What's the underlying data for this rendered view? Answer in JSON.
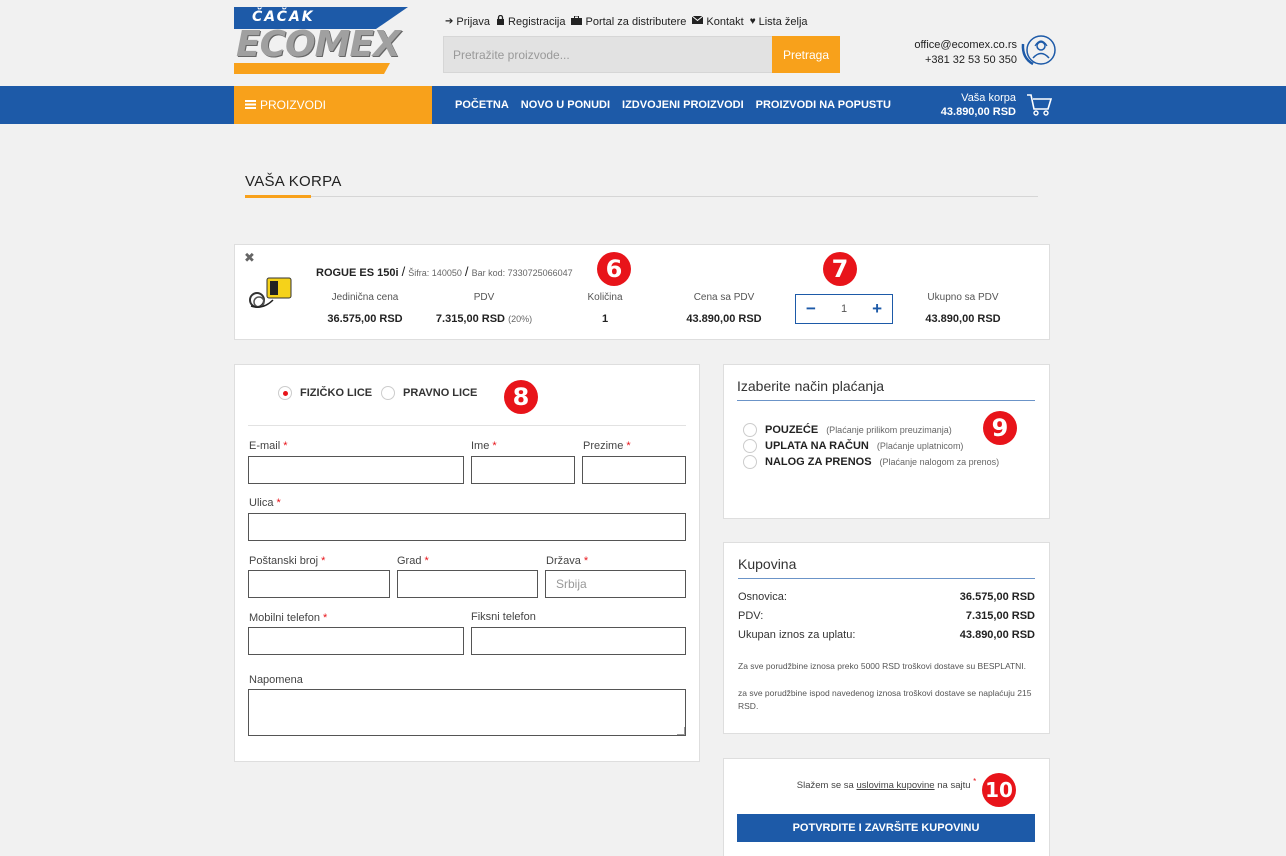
{
  "header": {
    "logo": {
      "top_text": "ČAČAK",
      "main_text": "ECOMEX"
    },
    "top_links": [
      {
        "icon": "sign-in-icon",
        "glyph": "➔",
        "label": "Prijava"
      },
      {
        "icon": "lock-icon",
        "glyph": "🔒",
        "label": "Registracija"
      },
      {
        "icon": "briefcase-icon",
        "glyph": "💼",
        "label": "Portal za distributere"
      },
      {
        "icon": "envelope-icon",
        "glyph": "✉",
        "label": "Kontakt"
      },
      {
        "icon": "heart-icon",
        "glyph": "♥",
        "label": "Lista želja"
      }
    ],
    "search": {
      "placeholder": "Pretražite proizvode...",
      "button": "Pretraga"
    },
    "contact": {
      "email": "office@ecomex.co.rs",
      "phone": "+381 32 53 50 350"
    }
  },
  "nav": {
    "products": "PROIZVODI",
    "links": [
      "POČETNA",
      "NOVO U PONUDI",
      "IZDVOJENI PROIZVODI",
      "PROIZVODI NA POPUSTU"
    ],
    "cart": {
      "label": "Vaša korpa",
      "amount": "43.890,00 RSD"
    }
  },
  "page": {
    "title": "VAŠA KORPA"
  },
  "cart_item": {
    "name": "ROGUE ES 150i",
    "sku": "Šifra: 140050",
    "barcode": "Bar kod: 7330725066047",
    "columns": {
      "unit_price": {
        "label": "Jedinična cena",
        "value": "36.575,00 RSD"
      },
      "vat": {
        "label": "PDV",
        "value": "7.315,00 RSD",
        "note": "(20%)"
      },
      "quantity": {
        "label": "Količina",
        "value": "1"
      },
      "price_with_vat": {
        "label": "Cena sa PDV",
        "value": "43.890,00 RSD"
      },
      "total_with_vat": {
        "label": "Ukupno sa PDV",
        "value": "43.890,00 RSD"
      }
    },
    "stepper": {
      "minus": "−",
      "value": "1",
      "plus": "+"
    }
  },
  "badges": {
    "b6": "6",
    "b7": "7",
    "b8": "8",
    "b9": "9",
    "b10": "10"
  },
  "customer_form": {
    "types": [
      {
        "label": "FIZIČKO LICE",
        "checked": true
      },
      {
        "label": "PRAVNO LICE",
        "checked": false
      }
    ],
    "fields": {
      "email": "E-mail",
      "first_name": "Ime",
      "last_name": "Prezime",
      "street": "Ulica",
      "postal": "Poštanski broj",
      "city": "Grad",
      "country": "Država",
      "country_placeholder": "Srbija",
      "mobile": "Mobilni telefon",
      "landline": "Fiksni telefon",
      "note": "Napomena"
    },
    "required_mark": "*"
  },
  "payment": {
    "title": "Izaberite način plaćanja",
    "options": [
      {
        "label": "POUZEĆE",
        "sub": "(Plaćanje prilikom preuzimanja)"
      },
      {
        "label": "UPLATA NA RAČUN",
        "sub": "(Plaćanje uplatnicom)"
      },
      {
        "label": "NALOG ZA PRENOS",
        "sub": "(Plaćanje nalogom za prenos)"
      }
    ]
  },
  "summary": {
    "title": "Kupovina",
    "rows": [
      {
        "label": "Osnovica:",
        "value": "36.575,00 RSD"
      },
      {
        "label": "PDV:",
        "value": "7.315,00 RSD"
      },
      {
        "label": "Ukupan iznos za uplatu:",
        "value": "43.890,00 RSD"
      }
    ],
    "note_1": "Za sve porudžbine iznosa preko 5000 RSD troškovi dostave su BESPLATNI.",
    "note_2": "za sve porudžbine ispod navedenog iznosa troškovi dostave se naplaćuju 215 RSD."
  },
  "terms": {
    "prefix": "Slažem se sa ",
    "link": "uslovima kupovine",
    "suffix": " na sajtu ",
    "required_mark": "*",
    "button": "POTVRDITE I ZAVRŠITE KUPOVINU"
  },
  "colors": {
    "brand_blue": "#1d5aa8",
    "accent_orange": "#f8a11b",
    "badge_red": "#e8141a"
  }
}
